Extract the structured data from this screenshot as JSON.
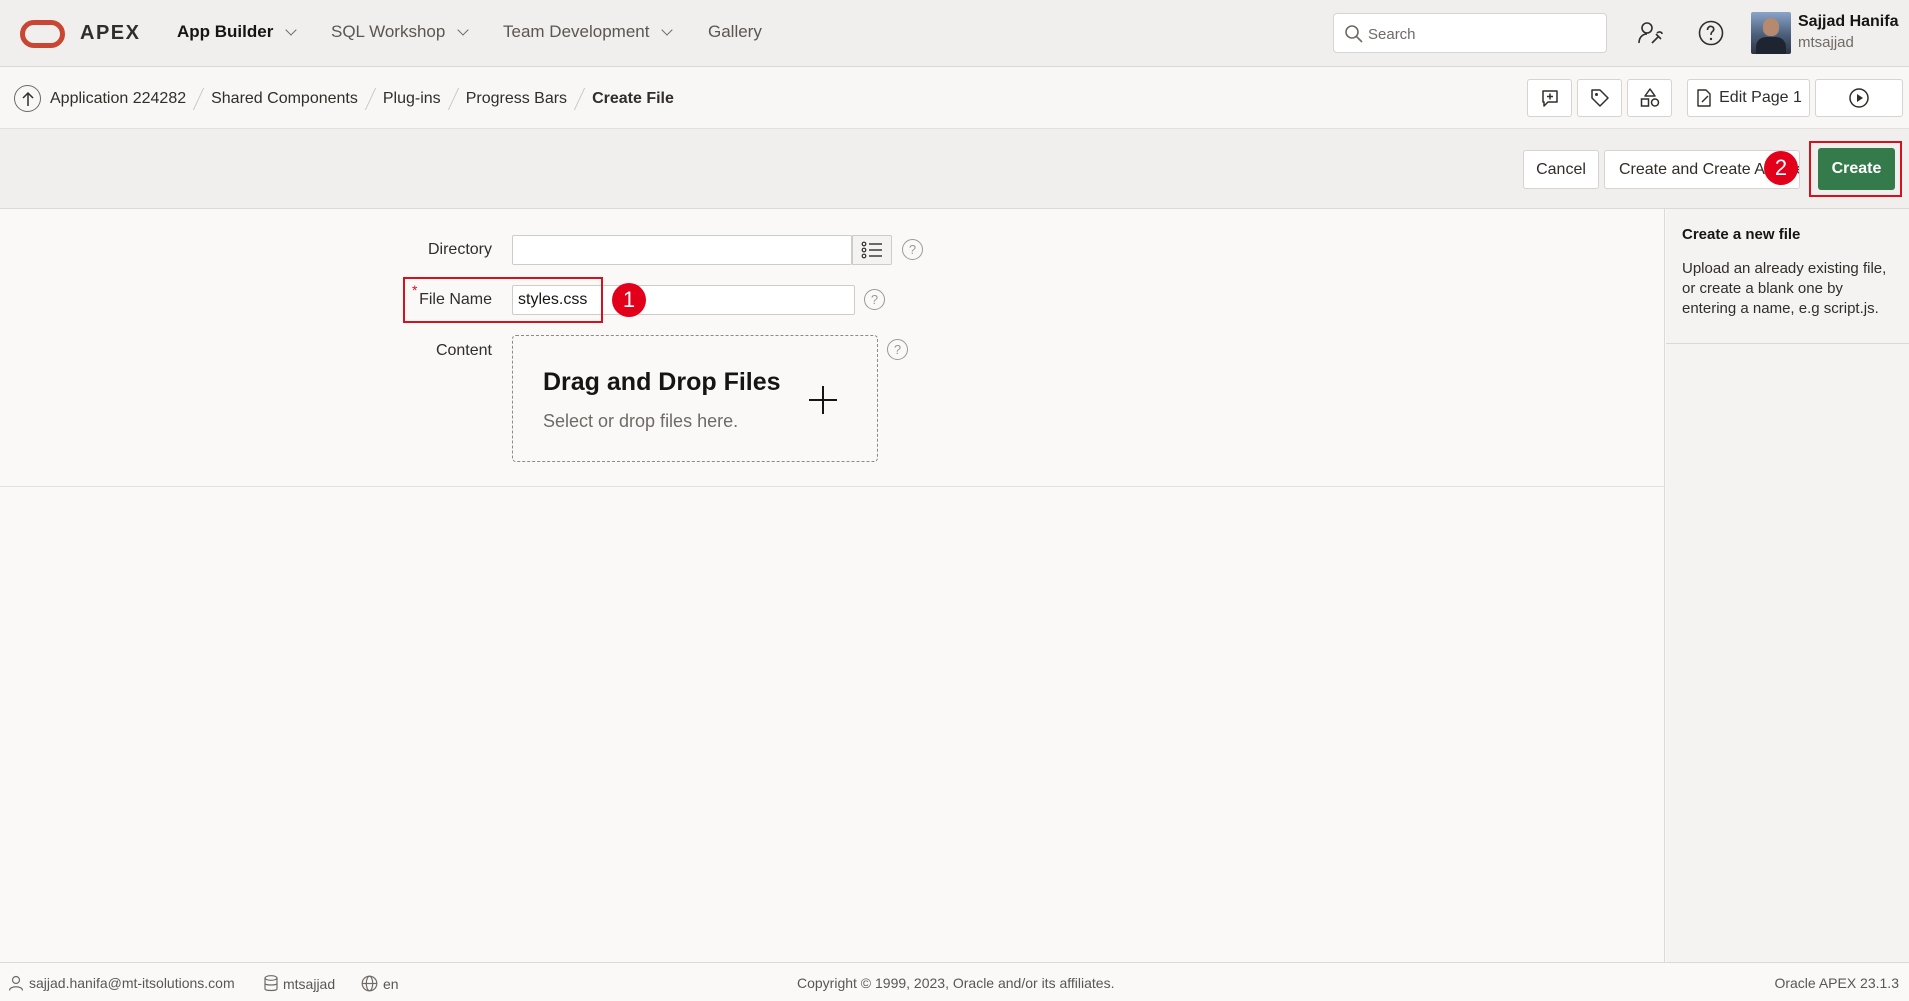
{
  "brand": {
    "name": "APEX",
    "logo_color": "#c74634"
  },
  "nav": {
    "items": [
      {
        "label": "App Builder",
        "active": true
      },
      {
        "label": "SQL Workshop",
        "active": false
      },
      {
        "label": "Team Development",
        "active": false
      },
      {
        "label": "Gallery",
        "active": false
      }
    ]
  },
  "search": {
    "placeholder": "Search"
  },
  "user": {
    "name": "Sajjad Hanifa",
    "id": "mtsajjad"
  },
  "breadcrumb": {
    "items": [
      "Application 224282",
      "Shared Components",
      "Plug-ins",
      "Progress Bars"
    ],
    "current": "Create File"
  },
  "toolbar": {
    "edit_page_label": "Edit Page 1"
  },
  "actions": {
    "cancel_label": "Cancel",
    "create_another_label": "Create and Create Another",
    "create_label": "Create",
    "create_color": "#357a4a"
  },
  "form": {
    "directory_label": "Directory",
    "directory_value": "",
    "file_name_label": "File Name",
    "file_name_value": "styles.css",
    "required_marker": "*",
    "content_label": "Content",
    "dropzone_title": "Drag and Drop Files",
    "dropzone_subtitle": "Select or drop files here.",
    "help_glyph": "?"
  },
  "annotations": {
    "marker_1": "1",
    "marker_2": "2",
    "highlight_color": "#d4121e"
  },
  "help_panel": {
    "title": "Create a new file",
    "text": "Upload an already existing file, or create a blank one by entering a name, e.g script.js."
  },
  "footer": {
    "email": "sajjad.hanifa@mt-itsolutions.com",
    "schema": "mtsajjad",
    "language": "en",
    "copyright": "Copyright © 1999, 2023, Oracle and/or its affiliates.",
    "version": "Oracle APEX 23.1.3"
  }
}
